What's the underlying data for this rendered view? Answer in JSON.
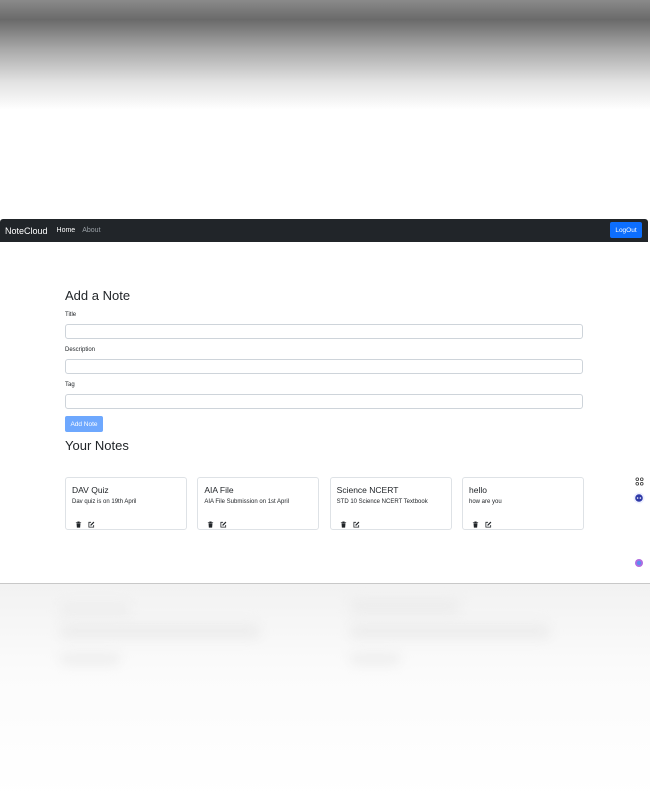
{
  "navbar": {
    "brand": "NoteCloud",
    "links": [
      "Home",
      "About"
    ],
    "logout_label": "LogOut"
  },
  "add_note": {
    "heading": "Add a Note",
    "title_label": "Title",
    "description_label": "Description",
    "tag_label": "Tag",
    "title_value": "",
    "description_value": "",
    "tag_value": "",
    "submit_label": "Add Note"
  },
  "notes": {
    "heading": "Your Notes",
    "items": [
      {
        "title": "DAV Quiz",
        "description": "Dav quiz is on 19th April"
      },
      {
        "title": "AIA File",
        "description": "AIA File Submission on 1st April"
      },
      {
        "title": "Science NCERT",
        "description": "STD 10 Science NCERT Textbook"
      },
      {
        "title": "hello",
        "description": "how are you"
      }
    ]
  },
  "colors": {
    "navbar_bg": "#212529",
    "primary": "#0d6efd",
    "primary_disabled": "#6ea8fe"
  },
  "icons": [
    "trash-icon",
    "edit-icon",
    "extension-icon",
    "bot-icon",
    "ai-icon"
  ]
}
